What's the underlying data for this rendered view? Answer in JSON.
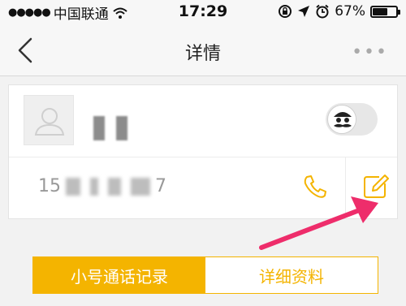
{
  "status_bar": {
    "signal": "●●●●●",
    "carrier": "中国联通",
    "time": "17:29",
    "battery_percent": "67%",
    "battery_level": 0.67
  },
  "navbar": {
    "back_icon": "chevron-left-icon",
    "title": "详情",
    "more_label": "•••"
  },
  "contact": {
    "phone_prefix": "15",
    "phone_suffix": "7"
  },
  "tabs": [
    {
      "label": "小号通话记录",
      "active": true
    },
    {
      "label": "详细资料",
      "active": false
    }
  ],
  "colors": {
    "accent": "#f4b400",
    "arrow": "#ee2d6b"
  }
}
